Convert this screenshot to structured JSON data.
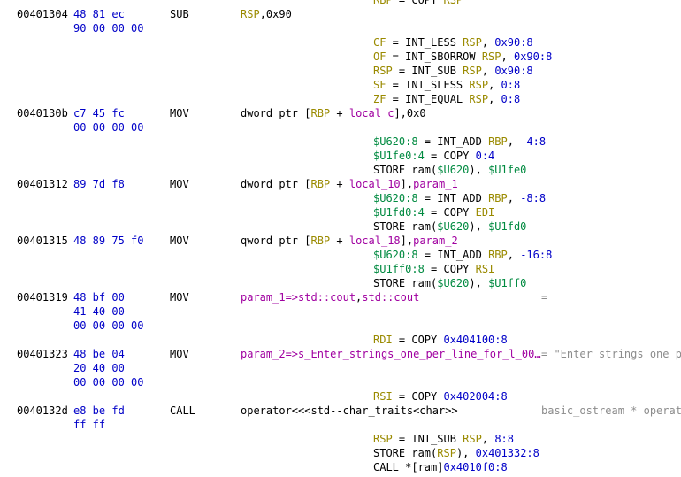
{
  "colors": {
    "address": "#000000",
    "bytes": "#0000c8",
    "register": "#9a8a00",
    "variable": "#a000a0",
    "pcode_unique": "#008a40",
    "comment": "#8c8c8c"
  },
  "lines": [
    {
      "pcode": [
        [
          "reg",
          "RBP"
        ],
        [
          "op",
          " = COPY "
        ],
        [
          "reg",
          "RSP"
        ]
      ]
    },
    {
      "addr": "00401304",
      "bytes": "48 81 ec",
      "mnem": "SUB",
      "ops": [
        [
          "reg",
          "RSP"
        ],
        [
          "plain",
          ",0x90"
        ]
      ]
    },
    {
      "bytes": "90 00 00 00"
    },
    {
      "pcode": [
        [
          "reg",
          "CF"
        ],
        [
          "op",
          " = INT_LESS "
        ],
        [
          "reg",
          "RSP"
        ],
        [
          "op",
          ", "
        ],
        [
          "const",
          "0x90:8"
        ]
      ]
    },
    {
      "pcode": [
        [
          "reg",
          "OF"
        ],
        [
          "op",
          " = INT_SBORROW "
        ],
        [
          "reg",
          "RSP"
        ],
        [
          "op",
          ", "
        ],
        [
          "const",
          "0x90:8"
        ]
      ]
    },
    {
      "pcode": [
        [
          "reg",
          "RSP"
        ],
        [
          "op",
          " = INT_SUB "
        ],
        [
          "reg",
          "RSP"
        ],
        [
          "op",
          ", "
        ],
        [
          "const",
          "0x90:8"
        ]
      ]
    },
    {
      "pcode": [
        [
          "reg",
          "SF"
        ],
        [
          "op",
          " = INT_SLESS "
        ],
        [
          "reg",
          "RSP"
        ],
        [
          "op",
          ", "
        ],
        [
          "const",
          "0:8"
        ]
      ]
    },
    {
      "pcode": [
        [
          "reg",
          "ZF"
        ],
        [
          "op",
          " = INT_EQUAL "
        ],
        [
          "reg",
          "RSP"
        ],
        [
          "op",
          ", "
        ],
        [
          "const",
          "0:8"
        ]
      ]
    },
    {
      "addr": "0040130b",
      "bytes": "c7 45 fc",
      "mnem": "MOV",
      "ops": [
        [
          "plain",
          "dword ptr ["
        ],
        [
          "reg",
          "RBP"
        ],
        [
          "plain",
          " + "
        ],
        [
          "var",
          "local_c"
        ],
        [
          "plain",
          "],0x0"
        ]
      ]
    },
    {
      "bytes": "00 00 00 00"
    },
    {
      "pcode": [
        [
          "uniq",
          "$U620:8"
        ],
        [
          "op",
          " = INT_ADD "
        ],
        [
          "reg",
          "RBP"
        ],
        [
          "op",
          ", "
        ],
        [
          "const",
          "-4:8"
        ]
      ]
    },
    {
      "pcode": [
        [
          "uniq",
          "$U1fe0:4"
        ],
        [
          "op",
          " = COPY "
        ],
        [
          "const",
          "0:4"
        ]
      ]
    },
    {
      "pcode": [
        [
          "op",
          "STORE ram("
        ],
        [
          "uniq",
          "$U620"
        ],
        [
          "op",
          "), "
        ],
        [
          "uniq",
          "$U1fe0"
        ]
      ]
    },
    {
      "addr": "00401312",
      "bytes": "89 7d f8",
      "mnem": "MOV",
      "ops": [
        [
          "plain",
          "dword ptr ["
        ],
        [
          "reg",
          "RBP"
        ],
        [
          "plain",
          " + "
        ],
        [
          "var",
          "local_10"
        ],
        [
          "plain",
          "],"
        ],
        [
          "var",
          "param_1"
        ]
      ]
    },
    {
      "pcode": [
        [
          "uniq",
          "$U620:8"
        ],
        [
          "op",
          " = INT_ADD "
        ],
        [
          "reg",
          "RBP"
        ],
        [
          "op",
          ", "
        ],
        [
          "const",
          "-8:8"
        ]
      ]
    },
    {
      "pcode": [
        [
          "uniq",
          "$U1fd0:4"
        ],
        [
          "op",
          " = COPY "
        ],
        [
          "reg",
          "EDI"
        ]
      ]
    },
    {
      "pcode": [
        [
          "op",
          "STORE ram("
        ],
        [
          "uniq",
          "$U620"
        ],
        [
          "op",
          "), "
        ],
        [
          "uniq",
          "$U1fd0"
        ]
      ]
    },
    {
      "addr": "00401315",
      "bytes": "48 89 75 f0",
      "mnem": "MOV",
      "ops": [
        [
          "plain",
          "qword ptr ["
        ],
        [
          "reg",
          "RBP"
        ],
        [
          "plain",
          " + "
        ],
        [
          "var",
          "local_18"
        ],
        [
          "plain",
          "],"
        ],
        [
          "var",
          "param_2"
        ]
      ]
    },
    {
      "pcode": [
        [
          "uniq",
          "$U620:8"
        ],
        [
          "op",
          " = INT_ADD "
        ],
        [
          "reg",
          "RBP"
        ],
        [
          "op",
          ", "
        ],
        [
          "const",
          "-16:8"
        ]
      ]
    },
    {
      "pcode": [
        [
          "uniq",
          "$U1ff0:8"
        ],
        [
          "op",
          " = COPY "
        ],
        [
          "reg",
          "RSI"
        ]
      ]
    },
    {
      "pcode": [
        [
          "op",
          "STORE ram("
        ],
        [
          "uniq",
          "$U620"
        ],
        [
          "op",
          "), "
        ],
        [
          "uniq",
          "$U1ff0"
        ]
      ]
    },
    {
      "addr": "00401319",
      "bytes": "48 bf 00",
      "mnem": "MOV",
      "ops": [
        [
          "var",
          "param_1=>std::cout"
        ],
        [
          "plain",
          ","
        ],
        [
          "var",
          "std::cout"
        ]
      ],
      "eol": "="
    },
    {
      "bytes": "41 40 00"
    },
    {
      "bytes": "00 00 00 00"
    },
    {
      "pcode": [
        [
          "reg",
          "RDI"
        ],
        [
          "op",
          " = COPY "
        ],
        [
          "const",
          "0x404100:8"
        ]
      ]
    },
    {
      "addr": "00401323",
      "bytes": "48 be 04",
      "mnem": "MOV",
      "ops": [
        [
          "var",
          "param_2=>s_Enter_strings_one_per_line_for_l_00…"
        ]
      ],
      "eol": "= \"Enter strings one pe"
    },
    {
      "bytes": "20 40 00"
    },
    {
      "bytes": "00 00 00 00"
    },
    {
      "pcode": [
        [
          "reg",
          "RSI"
        ],
        [
          "op",
          " = COPY "
        ],
        [
          "const",
          "0x402004:8"
        ]
      ]
    },
    {
      "addr": "0040132d",
      "bytes": "e8 be fd",
      "mnem": "CALL",
      "ops": [
        [
          "plain",
          "operator<<<std--char_traits<char>>"
        ]
      ],
      "eol": "basic_ostream * operato"
    },
    {
      "bytes": "ff ff"
    },
    {
      "pcode": [
        [
          "reg",
          "RSP"
        ],
        [
          "op",
          " = INT_SUB "
        ],
        [
          "reg",
          "RSP"
        ],
        [
          "op",
          ", "
        ],
        [
          "const",
          "8:8"
        ]
      ]
    },
    {
      "pcode": [
        [
          "op",
          "STORE ram("
        ],
        [
          "reg",
          "RSP"
        ],
        [
          "op",
          "), "
        ],
        [
          "const",
          "0x401332:8"
        ]
      ]
    },
    {
      "pcode": [
        [
          "op",
          "CALL *[ram]"
        ],
        [
          "const",
          "0x4010f0:8"
        ]
      ]
    }
  ]
}
